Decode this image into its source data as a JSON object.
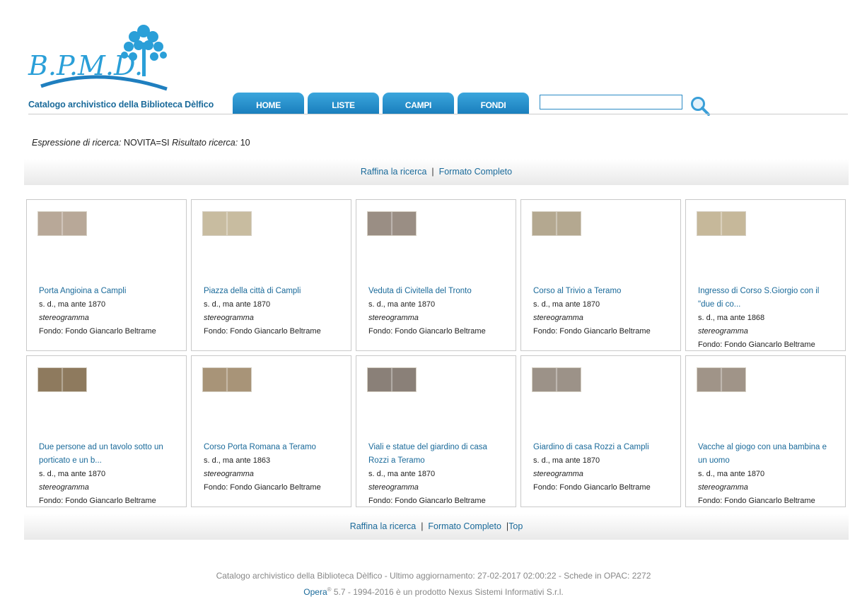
{
  "header": {
    "logo_text": "B.P.M.D.",
    "site_title": "Catalogo archivistico della Biblioteca Dèlfico",
    "nav": [
      "HOME",
      "LISTE",
      "CAMPI",
      "FONDI"
    ],
    "search_value": ""
  },
  "query": {
    "label": "Espressione di ricerca:",
    "value": "NOVITA=SI",
    "result_label": "Risultato ricerca:",
    "result_value": "10"
  },
  "top_bar": {
    "refine": "Raffina la ricerca",
    "sep": "|",
    "full": "Formato Completo"
  },
  "bottom_bar": {
    "refine": "Raffina la ricerca",
    "sep": "|",
    "full": "Formato Completo",
    "sep2": "|",
    "top": "Top"
  },
  "records": [
    {
      "title": "Porta Angioina a Campli",
      "date": "s. d., ma ante 1870",
      "type": "stereogramma",
      "fondo": "Fondo: Fondo Giancarlo Beltrame",
      "tone": "#b8a898"
    },
    {
      "title": "Piazza della città di Campli",
      "date": "s. d., ma ante 1870",
      "type": "stereogramma",
      "fondo": "Fondo: Fondo Giancarlo Beltrame",
      "tone": "#c8bca0"
    },
    {
      "title": "Veduta di Civitella del Tronto",
      "date": "s. d., ma ante 1870",
      "type": "stereogramma",
      "fondo": "Fondo: Fondo Giancarlo Beltrame",
      "tone": "#9a8e84"
    },
    {
      "title": "Corso al Trivio a Teramo",
      "date": "s. d., ma ante 1870",
      "type": "stereogramma",
      "fondo": "Fondo: Fondo Giancarlo Beltrame",
      "tone": "#b4a890"
    },
    {
      "title": "Ingresso di Corso S.Giorgio con il \"due di co...",
      "date": "s. d., ma ante 1868",
      "type": "stereogramma",
      "fondo": "Fondo: Fondo Giancarlo Beltrame",
      "tone": "#c6b89a"
    },
    {
      "title": "Due persone ad un tavolo sotto un porticato e un b...",
      "date": "s. d., ma ante 1870",
      "type": "stereogramma",
      "fondo": "Fondo: Fondo Giancarlo Beltrame",
      "tone": "#8e7a5e"
    },
    {
      "title": "Corso Porta Romana a Teramo",
      "date": "s. d., ma ante 1863",
      "type": "stereogramma",
      "fondo": "Fondo: Fondo Giancarlo Beltrame",
      "tone": "#a89478"
    },
    {
      "title": "Viali e statue del giardino di casa Rozzi a Teramo",
      "date": "s. d., ma ante 1870",
      "type": "stereogramma",
      "fondo": "Fondo: Fondo Giancarlo Beltrame",
      "tone": "#8a8078"
    },
    {
      "title": "Giardino di casa Rozzi a Campli",
      "date": "s. d., ma ante 1870",
      "type": "stereogramma",
      "fondo": "Fondo: Fondo Giancarlo Beltrame",
      "tone": "#9c9288"
    },
    {
      "title": "Vacche al giogo con una bambina e un uomo",
      "date": "s. d., ma ante 1870",
      "type": "stereogramma",
      "fondo": "Fondo: Fondo Giancarlo Beltrame",
      "tone": "#a09488"
    }
  ],
  "footer": {
    "line1": "Catalogo archivistico della Biblioteca Dèlfico - Ultimo aggiornamento: 27-02-2017 02:00:22 - Schede in OPAC:  2272",
    "brand": "Opera",
    "brand_mark": "®",
    "line2": " 5.7 - 1994-2016 è un prodotto Nexus Sistemi Informativi S.r.l."
  },
  "colors": {
    "accent": "#1a6a9a",
    "tab": "#2a93d1",
    "logo": "#2a9fd8"
  }
}
